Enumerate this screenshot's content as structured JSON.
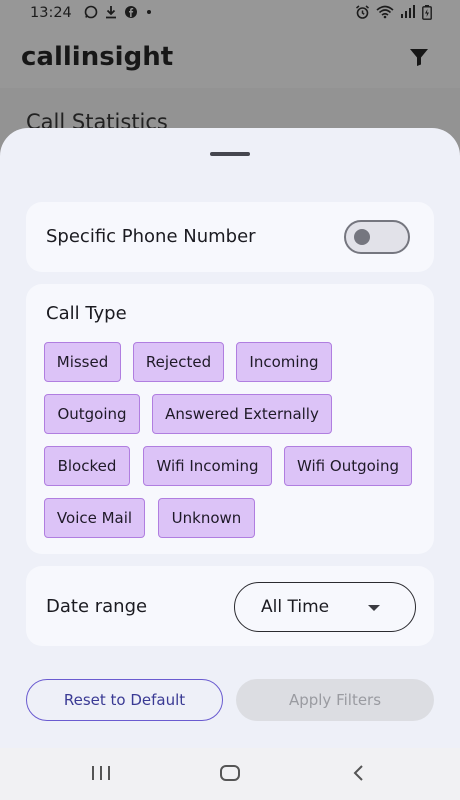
{
  "status_bar": {
    "time": "13:24",
    "left_icons": [
      "whatsapp-icon",
      "download-icon",
      "facebook-icon",
      "dot-icon"
    ],
    "right_icons": [
      "alarm-icon",
      "wifi-icon",
      "signal-icon",
      "battery-icon"
    ]
  },
  "app_bar": {
    "title": "callinsight",
    "filter_icon": "filter-icon"
  },
  "background": {
    "section_title": "Call Statistics"
  },
  "sheet": {
    "phone_card": {
      "label": "Specific Phone Number",
      "toggle_on": false
    },
    "call_type_card": {
      "label": "Call Type",
      "chips": [
        {
          "label": "Missed"
        },
        {
          "label": "Rejected"
        },
        {
          "label": "Incoming"
        },
        {
          "label": "Outgoing"
        },
        {
          "label": "Answered Externally"
        },
        {
          "label": "Blocked"
        },
        {
          "label": "Wifi Incoming"
        },
        {
          "label": "Wifi Outgoing"
        },
        {
          "label": "Voice Mail"
        },
        {
          "label": "Unknown"
        }
      ]
    },
    "date_card": {
      "label": "Date range",
      "selected": "All Time"
    },
    "reset_label": "Reset to Default",
    "apply_label": "Apply Filters"
  },
  "colors": {
    "chip_bg": "#dcc3f7",
    "chip_border": "#b07ee0",
    "accent": "#6a5bd0",
    "sheet_bg": "#eef0f8"
  },
  "nav_bar": {
    "icons": [
      "recents-icon",
      "home-icon",
      "back-icon"
    ]
  }
}
